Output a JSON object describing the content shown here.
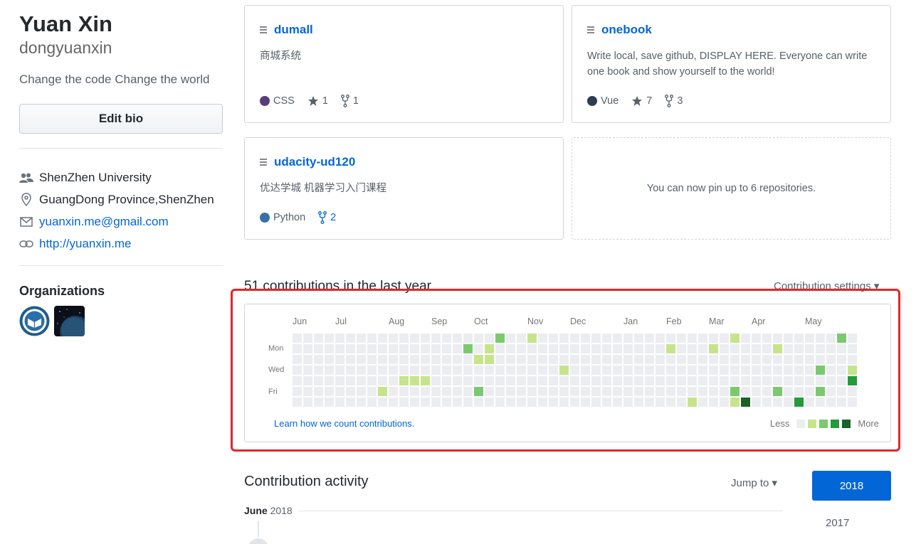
{
  "profile": {
    "name": "Yuan Xin",
    "username": "dongyuanxin",
    "bio": "Change the code Change the world",
    "edit_bio_label": "Edit bio",
    "company": "ShenZhen University",
    "location": "GuangDong Province,ShenZhen",
    "email": "yuanxin.me@gmail.com",
    "website": "http://yuanxin.me",
    "organizations_title": "Organizations"
  },
  "pinned": [
    {
      "name": "dumall",
      "description": "商城系统",
      "language": "CSS",
      "lang_color": "#563d7c",
      "stars": "1",
      "forks": "1"
    },
    {
      "name": "onebook",
      "description": "Write local, save github, DISPLAY HERE. Everyone can write one book and show yourself to the world!",
      "language": "Vue",
      "lang_color": "#2c3e50",
      "stars": "7",
      "forks": "3"
    },
    {
      "name": "udacity-ud120",
      "description": "优达学城 机器学习入门课程",
      "language": "Python",
      "lang_color": "#3572A5",
      "forks": "2"
    }
  ],
  "pin_hint": "You can now pin up to 6 repositories.",
  "contributions": {
    "title": "51 contributions in the last year",
    "settings_label": "Contribution settings ▾",
    "months": [
      "Jun",
      "Jul",
      "Aug",
      "Sep",
      "Oct",
      "Nov",
      "Dec",
      "Jan",
      "Feb",
      "Mar",
      "Apr",
      "May"
    ],
    "days": [
      "Mon",
      "Wed",
      "Fri"
    ],
    "learn_link": "Learn how we count contributions.",
    "legend_less": "Less",
    "legend_more": "More",
    "colors": [
      "#ebedf0",
      "#c6e48b",
      "#7bc96f",
      "#239a3b",
      "#196127"
    ],
    "active_cells": [
      [
        8,
        5,
        1
      ],
      [
        10,
        4,
        1
      ],
      [
        11,
        4,
        1
      ],
      [
        12,
        4,
        1
      ],
      [
        16,
        1,
        2
      ],
      [
        17,
        2,
        1
      ],
      [
        17,
        5,
        2
      ],
      [
        18,
        1,
        1
      ],
      [
        18,
        2,
        1
      ],
      [
        19,
        0,
        2
      ],
      [
        22,
        0,
        1
      ],
      [
        25,
        3,
        1
      ],
      [
        35,
        1,
        1
      ],
      [
        37,
        6,
        1
      ],
      [
        39,
        1,
        1
      ],
      [
        41,
        0,
        1
      ],
      [
        41,
        5,
        2
      ],
      [
        41,
        6,
        1
      ],
      [
        42,
        6,
        4
      ],
      [
        45,
        1,
        1
      ],
      [
        45,
        5,
        2
      ],
      [
        47,
        6,
        3
      ],
      [
        49,
        3,
        2
      ],
      [
        49,
        5,
        2
      ],
      [
        51,
        0,
        2
      ],
      [
        52,
        3,
        1
      ],
      [
        52,
        4,
        3
      ]
    ]
  },
  "activity": {
    "title": "Contribution activity",
    "jump_to": "Jump to ▾",
    "month_heading": "June",
    "month_year": "2018",
    "years": [
      "2018",
      "2017"
    ]
  }
}
